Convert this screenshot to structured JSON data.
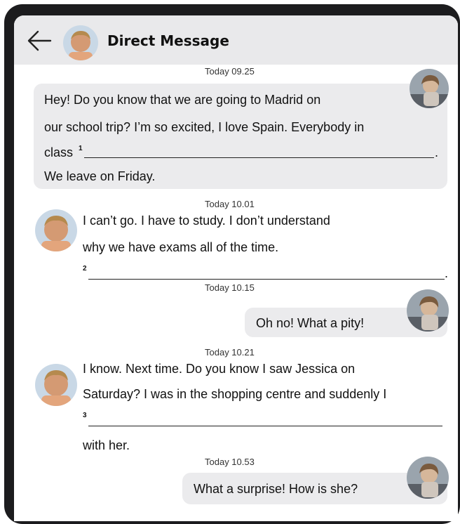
{
  "header": {
    "title": "Direct Message",
    "back_icon": "back-arrow-icon",
    "avatar": "boy-avatar"
  },
  "messages": [
    {
      "timestamp": "Today 09.25",
      "sender": "friend-girl",
      "lines": [
        "Hey! Do you know that we are going to Madrid on",
        "our school trip? I’m so excited, I love Spain. Everybody in",
        "class",
        "We leave on Friday."
      ],
      "gap_number": "1",
      "gap_end": "."
    },
    {
      "timestamp": "Today 10.01",
      "sender": "boy",
      "lines": [
        "I can’t go. I have to study. I don’t understand",
        "why we have exams all of the time."
      ],
      "gap_number": "2",
      "gap_end": "."
    },
    {
      "timestamp": "Today 10.15",
      "sender": "friend-girl",
      "lines": [
        "Oh no! What a pity!"
      ]
    },
    {
      "timestamp": "Today 10.21",
      "sender": "boy",
      "lines": [
        "I know. Next time. Do you know I saw Jessica on",
        "Saturday? I was in the shopping centre and suddenly I",
        "with her."
      ],
      "gap_number": "3"
    },
    {
      "timestamp": "Today 10.53",
      "sender": "friend-girl",
      "lines": [
        "What a surprise! How is she?"
      ]
    }
  ],
  "colors": {
    "header_bg": "#e9e9eb",
    "bubble_bg": "#ebebed",
    "bezel": "#1c1c1e"
  }
}
